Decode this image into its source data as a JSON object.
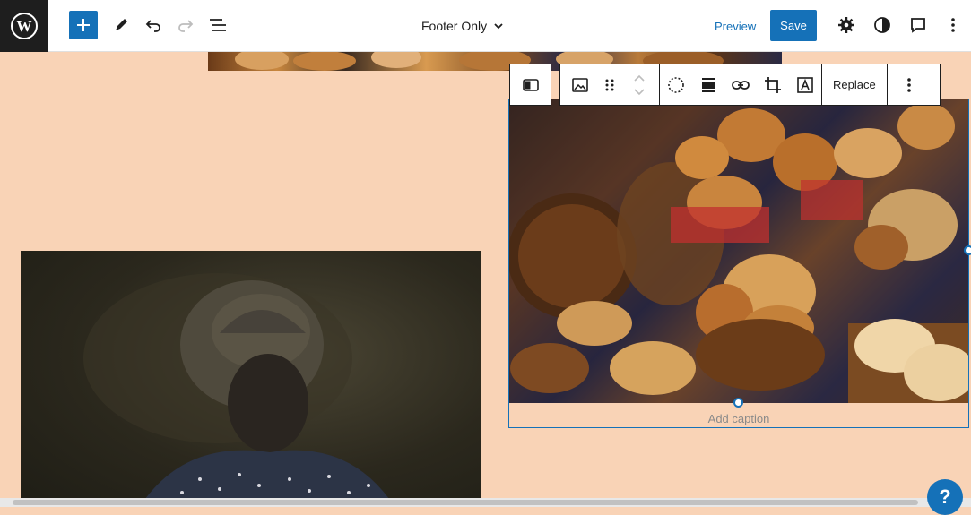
{
  "topbar": {
    "document_title": "Footer Only",
    "preview_label": "Preview",
    "save_label": "Save"
  },
  "block_toolbar": {
    "replace_label": "Replace"
  },
  "image_block": {
    "caption_placeholder": "Add caption"
  },
  "help": {
    "label": "?"
  },
  "colors": {
    "accent": "#1571b8",
    "canvas_background": "#f9d3b6",
    "topbar_background": "#ffffff",
    "logo_background": "#1e1e1e"
  },
  "icons": {
    "logo": "wordpress-logo",
    "add": "plus-icon",
    "tools": "pencil-icon",
    "undo": "undo-icon",
    "redo": "redo-icon",
    "list_view": "list-view-icon",
    "settings": "gear-icon",
    "styles": "half-circle-icon",
    "comments": "comment-icon",
    "options": "more-vertical-icon"
  }
}
